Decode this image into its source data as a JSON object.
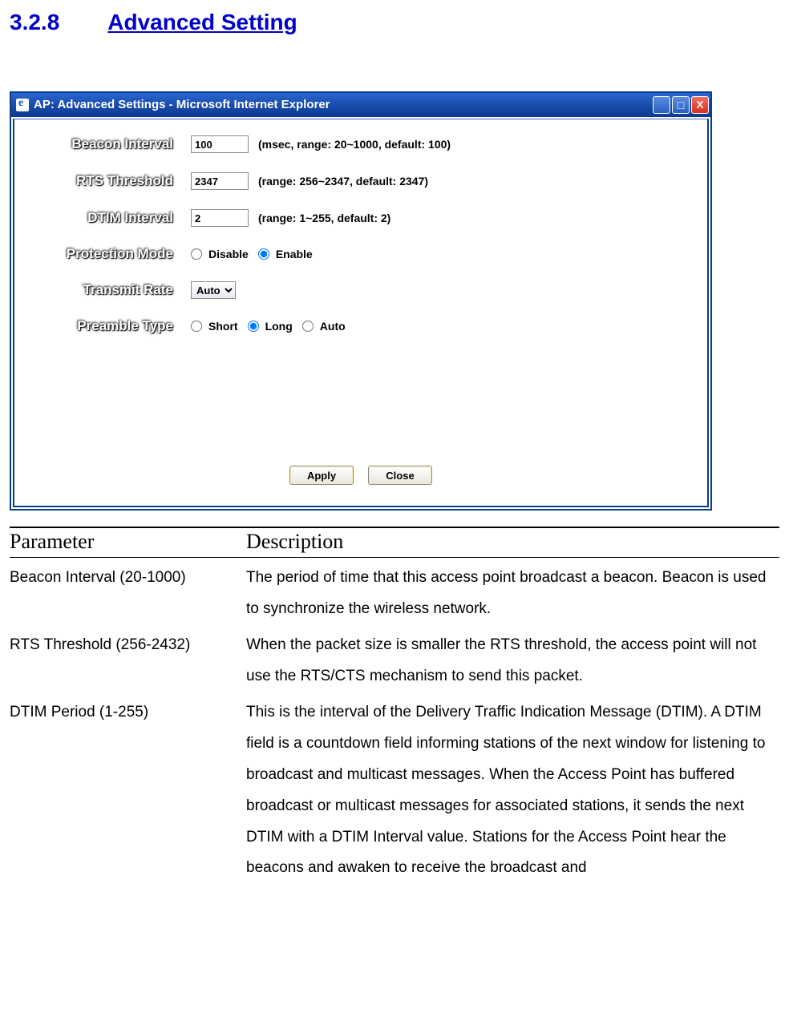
{
  "heading": {
    "number": "3.2.8",
    "title": "Advanced Setting"
  },
  "window": {
    "title": "AP: Advanced Settings - Microsoft Internet Explorer",
    "controls": {
      "min": "_",
      "max": "□",
      "close": "X"
    },
    "form": {
      "beacon": {
        "label": "Beacon Interval",
        "value": "100",
        "hint": "(msec, range: 20~1000, default: 100)"
      },
      "rts": {
        "label": "RTS Threshold",
        "value": "2347",
        "hint": "(range: 256~2347, default: 2347)"
      },
      "dtim": {
        "label": "DTIM Interval",
        "value": "2",
        "hint": "(range: 1~255, default: 2)"
      },
      "protection": {
        "label": "Protection Mode",
        "opt_disable": "Disable",
        "opt_enable": "Enable",
        "selected": "enable"
      },
      "rate": {
        "label": "Transmit Rate",
        "value": "Auto"
      },
      "preamble": {
        "label": "Preamble Type",
        "opt_short": "Short",
        "opt_long": "Long",
        "opt_auto": "Auto",
        "selected": "long"
      }
    },
    "buttons": {
      "apply": "Apply",
      "close": "Close"
    }
  },
  "table": {
    "head_param": "Parameter",
    "head_desc": "Description",
    "rows": [
      {
        "param": "Beacon Interval (20-1000)",
        "desc": "The period of time that this access point broadcast a beacon. Beacon is used to synchronize the wireless network."
      },
      {
        "param": "RTS Threshold (256-2432)",
        "desc": "When the packet size is smaller the RTS threshold, the access point will not use the RTS/CTS mechanism to send this packet."
      },
      {
        "param": "DTIM Period (1-255)",
        "desc": "This is the interval of the Delivery Traffic Indication Message (DTIM). A DTIM field is a countdown field informing stations of the next window for listening to broadcast and multicast messages. When the Access Point has buffered broadcast or multicast messages for associated stations, it sends the next DTIM with a DTIM Interval value. Stations for the Access Point hear the beacons and awaken to receive the broadcast and"
      }
    ]
  }
}
